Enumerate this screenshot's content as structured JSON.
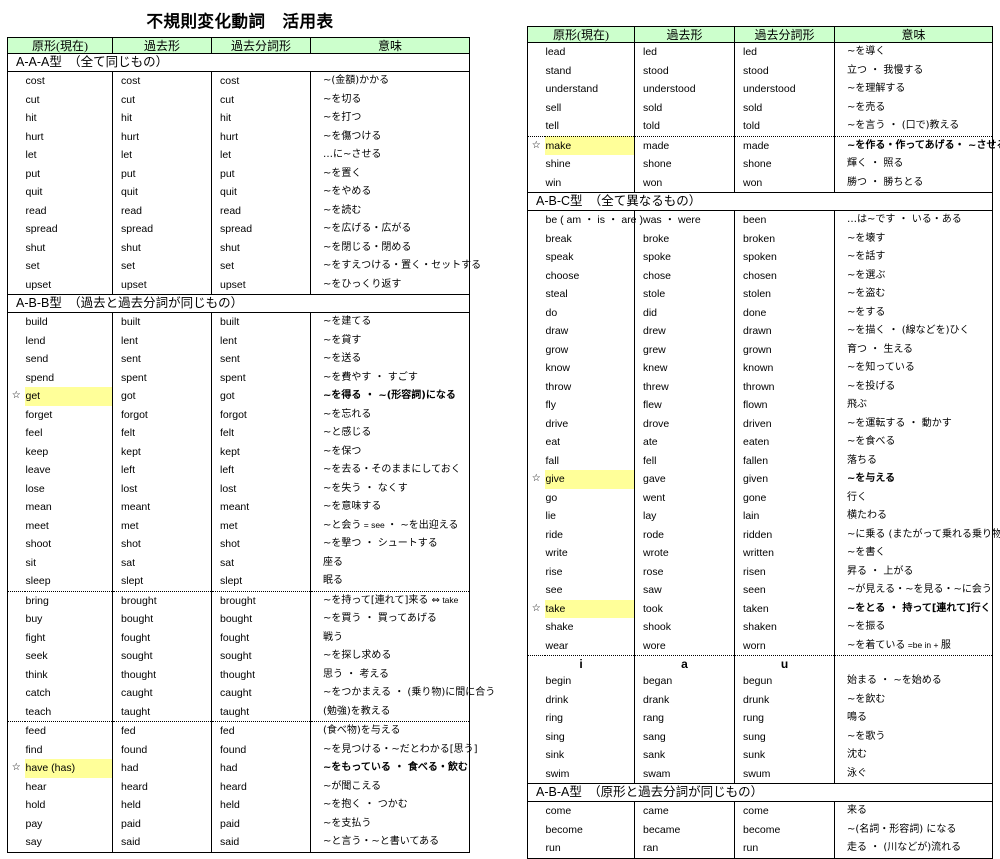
{
  "title": "不規則変化動詞　活用表",
  "columns": {
    "base": "原形(現在)",
    "past": "過去形",
    "pp": "過去分詞形",
    "meaning": "意味"
  },
  "star_glyph": "☆",
  "colors": {
    "header_green": "#ccffcc",
    "highlight_yellow": "#ffff99",
    "border": "#000000"
  },
  "left_table": {
    "sections": [
      {
        "label": "A-A-A型　（全て同じもの）",
        "rows": [
          {
            "star": "",
            "base": "cost",
            "past": "cost",
            "pp": "cost",
            "meaning": "~(金額)かかる",
            "hl": false,
            "sep": "none"
          },
          {
            "star": "",
            "base": "cut",
            "past": "cut",
            "pp": "cut",
            "meaning": "~を切る",
            "hl": false,
            "sep": "none"
          },
          {
            "star": "",
            "base": "hit",
            "past": "hit",
            "pp": "hit",
            "meaning": "~を打つ",
            "hl": false,
            "sep": "none"
          },
          {
            "star": "",
            "base": "hurt",
            "past": "hurt",
            "pp": "hurt",
            "meaning": "~を傷つける",
            "hl": false,
            "sep": "none"
          },
          {
            "star": "",
            "base": "let",
            "past": "let",
            "pp": "let",
            "meaning": "…に~させる",
            "hl": false,
            "sep": "none"
          },
          {
            "star": "",
            "base": "put",
            "past": "put",
            "pp": "put",
            "meaning": "~を置く",
            "hl": false,
            "sep": "none"
          },
          {
            "star": "",
            "base": "quit",
            "past": "quit",
            "pp": "quit",
            "meaning": "~をやめる",
            "hl": false,
            "sep": "none"
          },
          {
            "star": "",
            "base": "read",
            "past": "read",
            "pp": "read",
            "meaning": "~を読む",
            "hl": false,
            "sep": "none"
          },
          {
            "star": "",
            "base": "spread",
            "past": "spread",
            "pp": "spread",
            "meaning": "~を広げる・広がる",
            "hl": false,
            "sep": "none"
          },
          {
            "star": "",
            "base": "shut",
            "past": "shut",
            "pp": "shut",
            "meaning": "~を閉じる・閉める",
            "hl": false,
            "sep": "none"
          },
          {
            "star": "",
            "base": "set",
            "past": "set",
            "pp": "set",
            "meaning": "~をすえつける・置く・セットする",
            "hl": false,
            "sep": "none"
          },
          {
            "star": "",
            "base": "upset",
            "past": "upset",
            "pp": "upset",
            "meaning": "~をひっくり返す",
            "hl": false,
            "sep": "none"
          }
        ]
      },
      {
        "label": "A-B-B型　（過去と過去分詞が同じもの）",
        "rows": [
          {
            "star": "",
            "base": "build",
            "past": "built",
            "pp": "built",
            "meaning": "~を建てる",
            "hl": false,
            "sep": "none"
          },
          {
            "star": "",
            "base": "lend",
            "past": "lent",
            "pp": "lent",
            "meaning": "~を貸す",
            "hl": false,
            "sep": "none"
          },
          {
            "star": "",
            "base": "send",
            "past": "sent",
            "pp": "sent",
            "meaning": "~を送る",
            "hl": false,
            "sep": "none"
          },
          {
            "star": "",
            "base": "spend",
            "past": "spent",
            "pp": "spent",
            "meaning": "~を費やす ・ すごす",
            "hl": false,
            "sep": "none"
          },
          {
            "star": "☆",
            "base": "get",
            "past": "got",
            "pp": "got",
            "meaning": "~を得る ・ ~(形容詞)になる",
            "hl": true,
            "bold": true,
            "sep": "none"
          },
          {
            "star": "",
            "base": "forget",
            "past": "forgot",
            "pp": "forgot",
            "meaning": "~を忘れる",
            "hl": false,
            "sep": "none"
          },
          {
            "star": "",
            "base": "feel",
            "past": "felt",
            "pp": "felt",
            "meaning": "~と感じる",
            "hl": false,
            "sep": "none"
          },
          {
            "star": "",
            "base": "keep",
            "past": "kept",
            "pp": "kept",
            "meaning": "~を保つ",
            "hl": false,
            "sep": "none"
          },
          {
            "star": "",
            "base": "leave",
            "past": "left",
            "pp": "left",
            "meaning": "~を去る・そのままにしておく",
            "hl": false,
            "sep": "none"
          },
          {
            "star": "",
            "base": "lose",
            "past": "lost",
            "pp": "lost",
            "meaning": "~を失う ・ なくす",
            "hl": false,
            "sep": "none"
          },
          {
            "star": "",
            "base": "mean",
            "past": "meant",
            "pp": "meant",
            "meaning": "~を意味する",
            "hl": false,
            "sep": "none"
          },
          {
            "star": "",
            "base": "meet",
            "past": "met",
            "pp": "met",
            "meaning": "~と会う = see ・ ~を出迎える",
            "hl": false,
            "sep": "none"
          },
          {
            "star": "",
            "base": "shoot",
            "past": "shot",
            "pp": "shot",
            "meaning": "~を撃つ ・ シュートする",
            "hl": false,
            "sep": "none"
          },
          {
            "star": "",
            "base": "sit",
            "past": "sat",
            "pp": "sat",
            "meaning": "座る",
            "hl": false,
            "sep": "none"
          },
          {
            "star": "",
            "base": "sleep",
            "past": "slept",
            "pp": "slept",
            "meaning": "眠る",
            "hl": false,
            "sep": "none"
          },
          {
            "star": "",
            "base": "bring",
            "past": "brought",
            "pp": "brought",
            "meaning": "~を持って[連れて]来る ⇔ take",
            "hl": false,
            "sep": "dot"
          },
          {
            "star": "",
            "base": "buy",
            "past": "bought",
            "pp": "bought",
            "meaning": "~を買う ・ 買ってあげる",
            "hl": false,
            "sep": "none"
          },
          {
            "star": "",
            "base": "fight",
            "past": "fought",
            "pp": "fought",
            "meaning": "戦う",
            "hl": false,
            "sep": "none"
          },
          {
            "star": "",
            "base": "seek",
            "past": "sought",
            "pp": "sought",
            "meaning": "~を探し求める",
            "hl": false,
            "sep": "none"
          },
          {
            "star": "",
            "base": "think",
            "past": "thought",
            "pp": "thought",
            "meaning": "思う ・ 考える",
            "hl": false,
            "sep": "none"
          },
          {
            "star": "",
            "base": "catch",
            "past": "caught",
            "pp": "caught",
            "meaning": "~をつかまえる ・ (乗り物)に間に合う",
            "hl": false,
            "sep": "none"
          },
          {
            "star": "",
            "base": "teach",
            "past": "taught",
            "pp": "taught",
            "meaning": "(勉強)を教える",
            "hl": false,
            "sep": "none"
          },
          {
            "star": "",
            "base": "feed",
            "past": "fed",
            "pp": "fed",
            "meaning": "(食べ物)を与える",
            "hl": false,
            "sep": "dot"
          },
          {
            "star": "",
            "base": "find",
            "past": "found",
            "pp": "found",
            "meaning": "~を見つける・~だとわかる[思う]",
            "hl": false,
            "sep": "none"
          },
          {
            "star": "☆",
            "base": "have (has)",
            "past": "had",
            "pp": "had",
            "meaning": "~をもっている ・ 食べる・飲む",
            "hl": true,
            "bold": true,
            "sep": "none"
          },
          {
            "star": "",
            "base": "hear",
            "past": "heard",
            "pp": "heard",
            "meaning": "~が聞こえる",
            "hl": false,
            "sep": "none"
          },
          {
            "star": "",
            "base": "hold",
            "past": "held",
            "pp": "held",
            "meaning": "~を抱く ・ つかむ",
            "hl": false,
            "sep": "none"
          },
          {
            "star": "",
            "base": "pay",
            "past": "paid",
            "pp": "paid",
            "meaning": "~を支払う",
            "hl": false,
            "sep": "none"
          },
          {
            "star": "",
            "base": "say",
            "past": "said",
            "pp": "said",
            "meaning": "~と言う・~と書いてある",
            "hl": false,
            "sep": "none"
          }
        ]
      }
    ]
  },
  "right_table": {
    "sections": [
      {
        "label": null,
        "rows": [
          {
            "star": "",
            "base": "lead",
            "past": "led",
            "pp": "led",
            "meaning": "~を導く",
            "hl": false,
            "sep": "none"
          },
          {
            "star": "",
            "base": "stand",
            "past": "stood",
            "pp": "stood",
            "meaning": "立つ ・ 我慢する",
            "hl": false,
            "sep": "none"
          },
          {
            "star": "",
            "base": "understand",
            "past": "understood",
            "pp": "understood",
            "meaning": "~を理解する",
            "hl": false,
            "sep": "none"
          },
          {
            "star": "",
            "base": "sell",
            "past": "sold",
            "pp": "sold",
            "meaning": "~を売る",
            "hl": false,
            "sep": "none"
          },
          {
            "star": "",
            "base": "tell",
            "past": "told",
            "pp": "told",
            "meaning": "~を言う ・ (口で)教える",
            "hl": false,
            "sep": "none"
          },
          {
            "star": "☆",
            "base": "make",
            "past": "made",
            "pp": "made",
            "meaning": "~を作る・作ってあげる・ ~させる",
            "hl": true,
            "bold": true,
            "sep": "dot"
          },
          {
            "star": "",
            "base": "shine",
            "past": "shone",
            "pp": "shone",
            "meaning": "輝く ・ 照る",
            "hl": false,
            "sep": "none"
          },
          {
            "star": "",
            "base": "win",
            "past": "won",
            "pp": "won",
            "meaning": "勝つ ・ 勝ちとる",
            "hl": false,
            "sep": "none"
          }
        ]
      },
      {
        "label": "A-B-C型　（全て異なるもの）",
        "rows": [
          {
            "star": "",
            "base": "be ( am ・ is ・ are )",
            "past": "was ・ were",
            "pp": "been",
            "meaning": "…は~です ・ いる・ある",
            "hl": false,
            "sep": "none"
          },
          {
            "star": "",
            "base": "break",
            "past": "broke",
            "pp": "broken",
            "meaning": "~を壊す",
            "hl": false,
            "sep": "none"
          },
          {
            "star": "",
            "base": "speak",
            "past": "spoke",
            "pp": "spoken",
            "meaning": "~を話す",
            "hl": false,
            "sep": "none"
          },
          {
            "star": "",
            "base": "choose",
            "past": "chose",
            "pp": "chosen",
            "meaning": "~を選ぶ",
            "hl": false,
            "sep": "none"
          },
          {
            "star": "",
            "base": "steal",
            "past": "stole",
            "pp": "stolen",
            "meaning": "~を盗む",
            "hl": false,
            "sep": "none"
          },
          {
            "star": "",
            "base": "do",
            "past": "did",
            "pp": "done",
            "meaning": "~をする",
            "hl": false,
            "sep": "none"
          },
          {
            "star": "",
            "base": "draw",
            "past": "drew",
            "pp": "drawn",
            "meaning": "~を描く ・ (線などを)ひく",
            "hl": false,
            "sep": "none"
          },
          {
            "star": "",
            "base": "grow",
            "past": "grew",
            "pp": "grown",
            "meaning": "育つ ・ 生える",
            "hl": false,
            "sep": "none"
          },
          {
            "star": "",
            "base": "know",
            "past": "knew",
            "pp": "known",
            "meaning": "~を知っている",
            "hl": false,
            "sep": "none"
          },
          {
            "star": "",
            "base": "throw",
            "past": "threw",
            "pp": "thrown",
            "meaning": "~を投げる",
            "hl": false,
            "sep": "none"
          },
          {
            "star": "",
            "base": "fly",
            "past": "flew",
            "pp": "flown",
            "meaning": "飛ぶ",
            "hl": false,
            "sep": "none"
          },
          {
            "star": "",
            "base": "drive",
            "past": "drove",
            "pp": "driven",
            "meaning": "~を運転する ・ 動かす",
            "hl": false,
            "sep": "none"
          },
          {
            "star": "",
            "base": "eat",
            "past": "ate",
            "pp": "eaten",
            "meaning": "~を食べる",
            "hl": false,
            "sep": "none"
          },
          {
            "star": "",
            "base": "fall",
            "past": "fell",
            "pp": "fallen",
            "meaning": "落ちる",
            "hl": false,
            "sep": "none"
          },
          {
            "star": "☆",
            "base": "give",
            "past": "gave",
            "pp": "given",
            "meaning": "~を与える",
            "hl": true,
            "bold": true,
            "sep": "none"
          },
          {
            "star": "",
            "base": "go",
            "past": "went",
            "pp": "gone",
            "meaning": "行く",
            "hl": false,
            "sep": "none"
          },
          {
            "star": "",
            "base": "lie",
            "past": "lay",
            "pp": "lain",
            "meaning": "横たわる",
            "hl": false,
            "sep": "none"
          },
          {
            "star": "",
            "base": "ride",
            "past": "rode",
            "pp": "ridden",
            "meaning": "~に乗る (またがって乗れる乗り物)",
            "hl": false,
            "sep": "none"
          },
          {
            "star": "",
            "base": "write",
            "past": "wrote",
            "pp": "written",
            "meaning": "~を書く",
            "hl": false,
            "sep": "none"
          },
          {
            "star": "",
            "base": "rise",
            "past": "rose",
            "pp": "risen",
            "meaning": "昇る ・ 上がる",
            "hl": false,
            "sep": "none"
          },
          {
            "star": "",
            "base": "see",
            "past": "saw",
            "pp": "seen",
            "meaning": "~が見える・~を見る・~に会う",
            "hl": false,
            "sep": "none"
          },
          {
            "star": "☆",
            "base": "take",
            "past": "took",
            "pp": "taken",
            "meaning": "~をとる ・ 持って[連れて]行く",
            "hl": true,
            "bold": true,
            "sep": "none"
          },
          {
            "star": "",
            "base": "shake",
            "past": "shook",
            "pp": "shaken",
            "meaning": "~を振る",
            "hl": false,
            "sep": "none"
          },
          {
            "star": "",
            "base": "wear",
            "past": "wore",
            "pp": "worn",
            "meaning": "~を着ている  =be in + 服",
            "hl": false,
            "sep": "none"
          }
        ]
      },
      {
        "subhead": {
          "base": "i",
          "past": "a",
          "pp": "u",
          "meaning": ""
        },
        "rows": [
          {
            "star": "",
            "base": "begin",
            "past": "began",
            "pp": "begun",
            "meaning": "始まる ・ ~を始める",
            "hl": false,
            "sep": "none"
          },
          {
            "star": "",
            "base": "drink",
            "past": "drank",
            "pp": "drunk",
            "meaning": "~を飲む",
            "hl": false,
            "sep": "none"
          },
          {
            "star": "",
            "base": "ring",
            "past": "rang",
            "pp": "rung",
            "meaning": "鳴る",
            "hl": false,
            "sep": "none"
          },
          {
            "star": "",
            "base": "sing",
            "past": "sang",
            "pp": "sung",
            "meaning": "~を歌う",
            "hl": false,
            "sep": "none"
          },
          {
            "star": "",
            "base": "sink",
            "past": "sank",
            "pp": "sunk",
            "meaning": "沈む",
            "hl": false,
            "sep": "none"
          },
          {
            "star": "",
            "base": "swim",
            "past": "swam",
            "pp": "swum",
            "meaning": "泳ぐ",
            "hl": false,
            "sep": "none"
          }
        ]
      },
      {
        "label": "A-B-A型　（原形と過去分詞が同じもの）",
        "rows": [
          {
            "star": "",
            "base": "come",
            "past": "came",
            "pp": "come",
            "meaning": "来る",
            "hl": false,
            "sep": "none"
          },
          {
            "star": "",
            "base": "become",
            "past": "became",
            "pp": "become",
            "meaning": "~(名詞・形容詞) になる",
            "hl": false,
            "sep": "none"
          },
          {
            "star": "",
            "base": "run",
            "past": "ran",
            "pp": "run",
            "meaning": "走る ・ (川などが)流れる",
            "hl": false,
            "sep": "none"
          }
        ]
      }
    ]
  }
}
